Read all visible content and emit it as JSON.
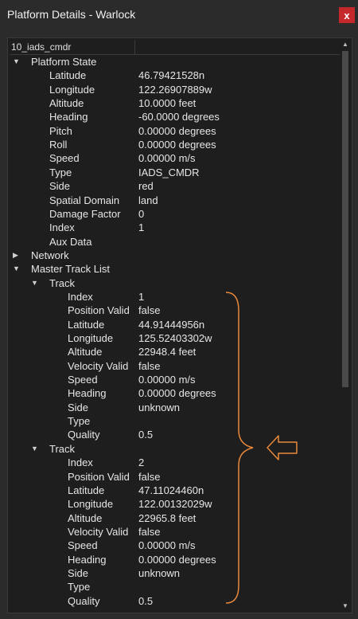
{
  "window": {
    "title": "Platform Details - Warlock",
    "close_label": "x"
  },
  "header": {
    "col1": "10_iads_cmdr"
  },
  "platform_state": {
    "label": "Platform State",
    "fields": [
      {
        "k": "Latitude",
        "v": "46.79421528n"
      },
      {
        "k": "Longitude",
        "v": "122.26907889w"
      },
      {
        "k": "Altitude",
        "v": "10.0000 feet"
      },
      {
        "k": "Heading",
        "v": "-60.0000 degrees"
      },
      {
        "k": "Pitch",
        "v": "0.00000 degrees"
      },
      {
        "k": "Roll",
        "v": "0.00000 degrees"
      },
      {
        "k": "Speed",
        "v": "0.00000 m/s"
      },
      {
        "k": "Type",
        "v": "IADS_CMDR"
      },
      {
        "k": "Side",
        "v": "red"
      },
      {
        "k": "Spatial Domain",
        "v": "land"
      },
      {
        "k": "Damage Factor",
        "v": "0"
      },
      {
        "k": "Index",
        "v": "1"
      },
      {
        "k": "Aux Data",
        "v": ""
      }
    ]
  },
  "network": {
    "label": "Network"
  },
  "master_track_list": {
    "label": "Master Track List",
    "tracks": [
      {
        "label": "Track",
        "fields": [
          {
            "k": "Index",
            "v": "1"
          },
          {
            "k": "Position Valid",
            "v": "false"
          },
          {
            "k": "Latitude",
            "v": "44.91444956n"
          },
          {
            "k": "Longitude",
            "v": "125.52403302w"
          },
          {
            "k": "Altitude",
            "v": "22948.4 feet"
          },
          {
            "k": "Velocity Valid",
            "v": "false"
          },
          {
            "k": "Speed",
            "v": "0.00000 m/s"
          },
          {
            "k": "Heading",
            "v": "0.00000 degrees"
          },
          {
            "k": "Side",
            "v": "unknown"
          },
          {
            "k": "Type",
            "v": ""
          },
          {
            "k": "Quality",
            "v": "0.5"
          }
        ]
      },
      {
        "label": "Track",
        "fields": [
          {
            "k": "Index",
            "v": "2"
          },
          {
            "k": "Position Valid",
            "v": "false"
          },
          {
            "k": "Latitude",
            "v": "47.11024460n"
          },
          {
            "k": "Longitude",
            "v": "122.00132029w"
          },
          {
            "k": "Altitude",
            "v": "22965.8 feet"
          },
          {
            "k": "Velocity Valid",
            "v": "false"
          },
          {
            "k": "Speed",
            "v": "0.00000 m/s"
          },
          {
            "k": "Heading",
            "v": "0.00000 degrees"
          },
          {
            "k": "Side",
            "v": "unknown"
          },
          {
            "k": "Type",
            "v": ""
          },
          {
            "k": "Quality",
            "v": "0.5"
          }
        ]
      }
    ]
  },
  "annotation": {
    "color": "#e8883a",
    "icon": "arrow-left-outline-icon"
  }
}
